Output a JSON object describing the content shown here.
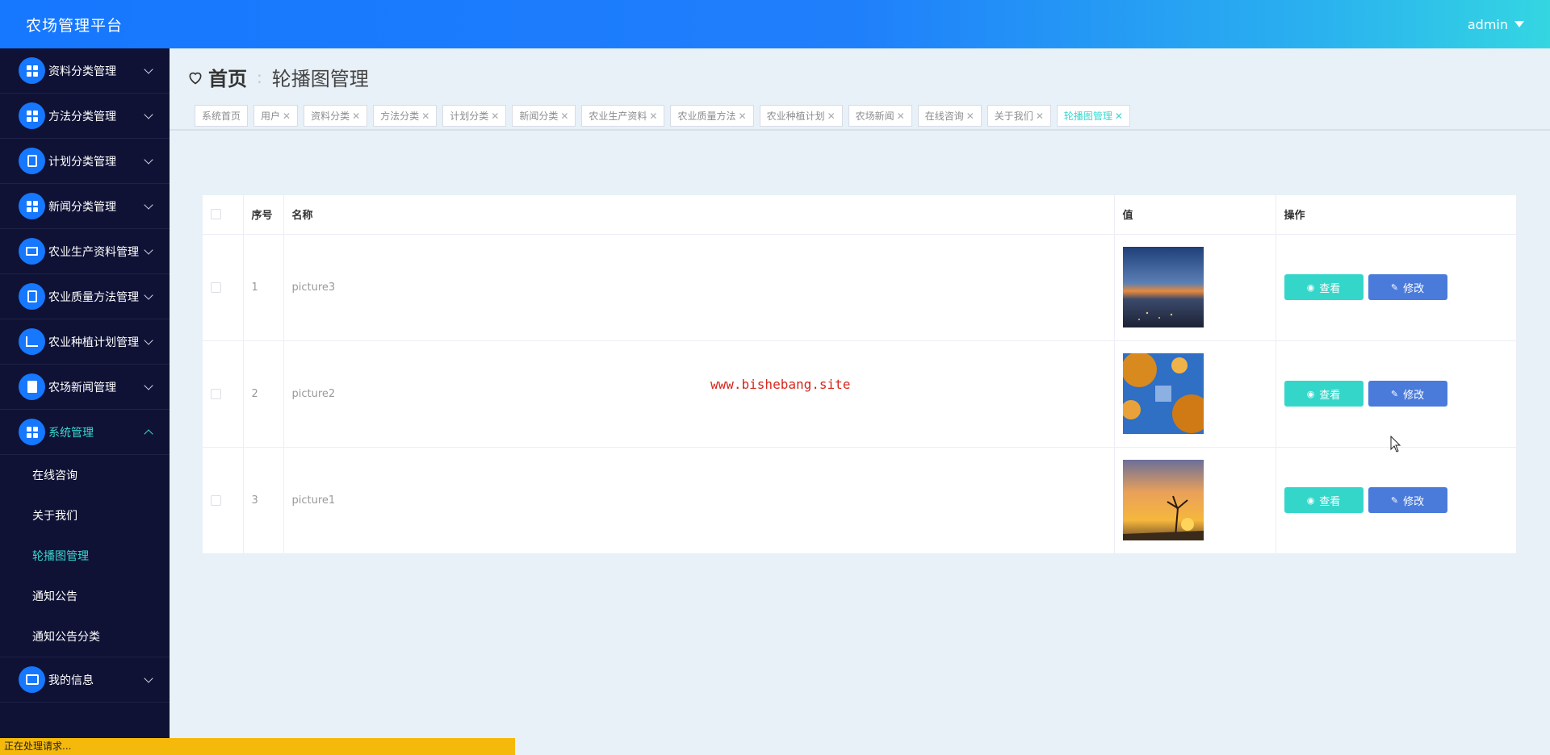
{
  "header": {
    "title": "农场管理平台",
    "user": "admin"
  },
  "sidebar": {
    "items": [
      {
        "label": "资料分类管理",
        "icon": "grid-icon"
      },
      {
        "label": "方法分类管理",
        "icon": "grid-icon"
      },
      {
        "label": "计划分类管理",
        "icon": "clipboard-icon"
      },
      {
        "label": "新闻分类管理",
        "icon": "grid-icon"
      },
      {
        "label": "农业生产资料管理",
        "icon": "monitor-icon"
      },
      {
        "label": "农业质量方法管理",
        "icon": "document-icon"
      },
      {
        "label": "农业种植计划管理",
        "icon": "chart-icon"
      },
      {
        "label": "农场新闻管理",
        "icon": "book-icon"
      },
      {
        "label": "系统管理",
        "icon": "grid-icon"
      },
      {
        "label": "我的信息",
        "icon": "card-icon"
      }
    ],
    "system_submenu": [
      "在线咨询",
      "关于我们",
      "轮播图管理",
      "通知公告",
      "通知公告分类"
    ]
  },
  "breadcrumb": {
    "home": "首页",
    "separator": ":",
    "current": "轮播图管理"
  },
  "tabs": [
    {
      "label": "系统首页",
      "closable": false
    },
    {
      "label": "用户",
      "closable": true
    },
    {
      "label": "资料分类",
      "closable": true
    },
    {
      "label": "方法分类",
      "closable": true
    },
    {
      "label": "计划分类",
      "closable": true
    },
    {
      "label": "新闻分类",
      "closable": true
    },
    {
      "label": "农业生产资料",
      "closable": true
    },
    {
      "label": "农业质量方法",
      "closable": true
    },
    {
      "label": "农业种植计划",
      "closable": true
    },
    {
      "label": "农场新闻",
      "closable": true
    },
    {
      "label": "在线咨询",
      "closable": true
    },
    {
      "label": "关于我们",
      "closable": true
    },
    {
      "label": "轮播图管理",
      "closable": true
    }
  ],
  "table": {
    "headers": {
      "index": "序号",
      "name": "名称",
      "value": "值",
      "actions": "操作"
    },
    "rows": [
      {
        "index": "1",
        "name": "picture3",
        "image": "dusk-city-photo"
      },
      {
        "index": "2",
        "name": "picture2",
        "image": "autumn-leaves-photo"
      },
      {
        "index": "3",
        "name": "picture1",
        "image": "sunset-tree-photo"
      }
    ],
    "view_label": "查看",
    "edit_label": "修改"
  },
  "watermark": "www.bishebang.site",
  "status_bar": "正在处理请求...",
  "colors": {
    "header_start": "#1677ff",
    "header_end": "#34d6e2",
    "sidebar_bg": "#0f1235",
    "accent": "#3ad8cf",
    "view_button": "#35d6ca",
    "edit_button": "#4a7bdb"
  }
}
